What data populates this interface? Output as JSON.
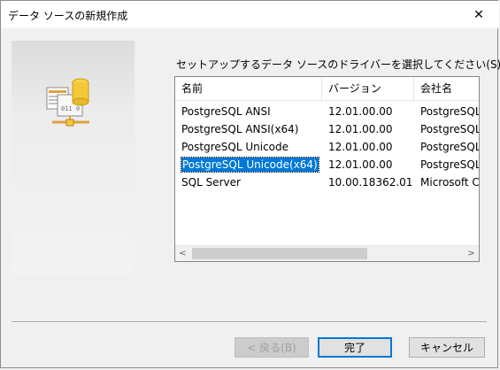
{
  "window": {
    "title": "データ ソースの新規作成",
    "close_glyph": "✕"
  },
  "prompt": "セットアップするデータ ソースのドライバーを選択してください(S)",
  "driver_list": {
    "columns": [
      "名前",
      "バージョン",
      "会社名"
    ],
    "rows": [
      {
        "name": "PostgreSQL ANSI",
        "version": "12.01.00.00",
        "company": "PostgreSQL Global Development Group",
        "selected": false
      },
      {
        "name": "PostgreSQL ANSI(x64)",
        "version": "12.01.00.00",
        "company": "PostgreSQL Global Development Group",
        "selected": false
      },
      {
        "name": "PostgreSQL Unicode",
        "version": "12.01.00.00",
        "company": "PostgreSQL Global Development Group",
        "selected": false
      },
      {
        "name": "PostgreSQL Unicode(x64)",
        "version": "12.01.00.00",
        "company": "PostgreSQL Global Development Group",
        "selected": true
      },
      {
        "name": "SQL Server",
        "version": "10.00.18362.01",
        "company": "Microsoft Corporation",
        "selected": false
      }
    ]
  },
  "scrollbar": {
    "left_arrow": "<",
    "right_arrow": ">"
  },
  "buttons": {
    "back": "< 戻る(B)",
    "finish": "完了",
    "cancel": "キャンセル"
  },
  "colors": {
    "selection": "#0078d7",
    "default_button_border": "#0078d7",
    "dialog_bg": "#f0f0f0"
  },
  "icons": {
    "wizard": "odbc-data-source-icon",
    "close": "close-icon"
  }
}
